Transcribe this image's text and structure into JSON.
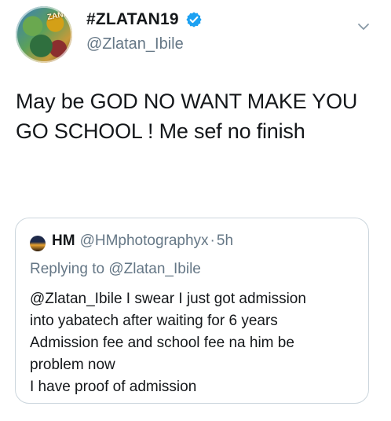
{
  "tweet": {
    "display_name": "#ZLATAN19",
    "handle": "@Zlatan_Ibile",
    "verified": true,
    "text": "May be GOD NO WANT MAKE YOU GO SCHOOL ! Me sef no finish",
    "avatar_text": "ZANKU"
  },
  "quoted_tweet": {
    "name": "HM",
    "handle": "@HMphotographyx",
    "separator": "·",
    "time": "5h",
    "replying_to": "Replying to @Zlatan_Ibile",
    "lines": [
      "@Zlatan_Ibile I swear I just got admission",
      "into yabatech after waiting for 6 years",
      "Admission fee and school fee na him be",
      "problem now",
      "I have proof of admission"
    ]
  },
  "colors": {
    "text": "#14171a",
    "secondary": "#657786",
    "verified": "#1da1f2",
    "border": "#ccd6dd"
  },
  "icons": {
    "verified": "verified-badge-icon",
    "caret": "chevron-down-icon"
  }
}
